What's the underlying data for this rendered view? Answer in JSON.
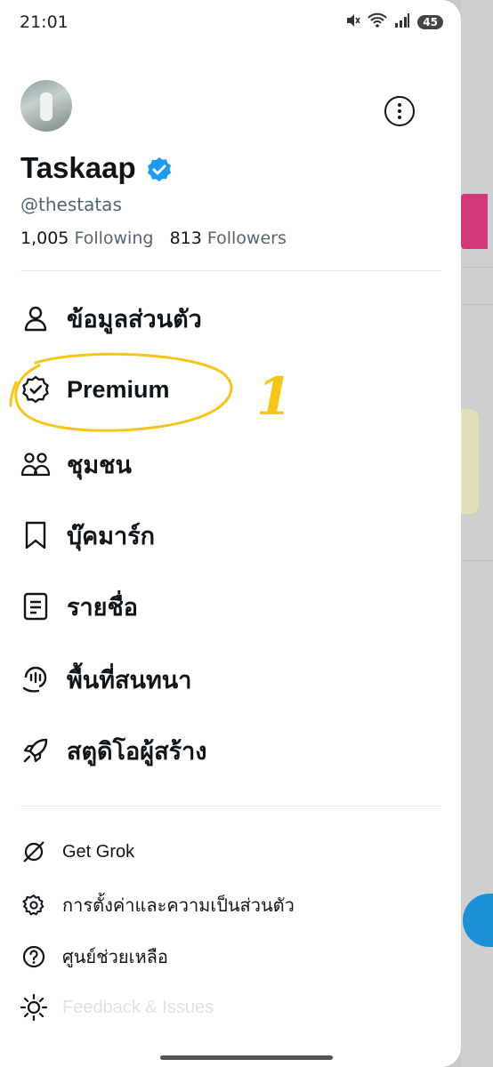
{
  "status_bar": {
    "time": "21:01",
    "battery": "45"
  },
  "profile": {
    "display_name": "Taskaap",
    "handle": "@thestatas",
    "following_count": "1,005",
    "following_label": "Following",
    "followers_count": "813",
    "followers_label": "Followers"
  },
  "menu": [
    {
      "label": "ข้อมูลส่วนตัว",
      "icon": "person-icon"
    },
    {
      "label": "Premium",
      "icon": "verified-badge-icon"
    },
    {
      "label": "ชุมชน",
      "icon": "communities-icon"
    },
    {
      "label": "บุ๊คมาร์ก",
      "icon": "bookmark-icon"
    },
    {
      "label": "รายชื่อ",
      "icon": "list-icon"
    },
    {
      "label": "พื้นที่สนทนา",
      "icon": "spaces-icon"
    },
    {
      "label": "สตูดิโอผู้สร้าง",
      "icon": "rocket-icon"
    }
  ],
  "secondary": [
    {
      "label": "Get Grok",
      "icon": "grok-icon"
    },
    {
      "label": "การตั้งค่าและความเป็นส่วนตัว",
      "icon": "gear-icon"
    },
    {
      "label": "ศูนย์ช่วยเหลือ",
      "icon": "help-icon"
    },
    {
      "label": "Feedback & Issues",
      "icon": "sun-icon"
    }
  ],
  "annotation": {
    "text": "1",
    "color": "#f5c518"
  },
  "colors": {
    "verified": "#1d9bf0",
    "text": "#0f1419",
    "secondary_text": "#536471"
  }
}
